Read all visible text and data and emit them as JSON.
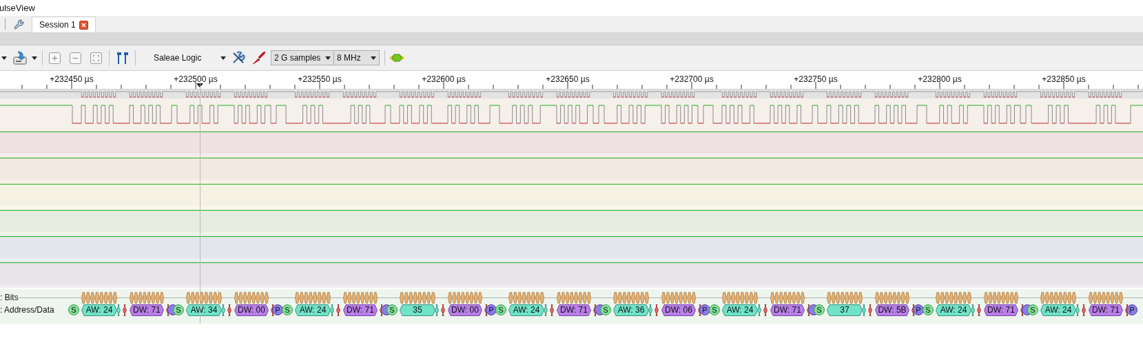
{
  "window": {
    "title": "ulseView"
  },
  "tabs": [
    {
      "label": "Session 1",
      "selected": true
    }
  ],
  "toolbar": {
    "device": "Saleae Logic",
    "sample_count": "2 G samples",
    "sample_rate": "8 MHz"
  },
  "ruler": {
    "labels": [
      "+232450 µs",
      "+232500 µs",
      "+232550 µs",
      "+232600 µs",
      "+232650 µs",
      "+232700 µs",
      "+232750 µs",
      "+232800 µs",
      "+232850 µs"
    ]
  },
  "decoder": {
    "rows": [
      ": Bits",
      ": Address/Data"
    ],
    "transactions": [
      {
        "start": "S",
        "address": "AW: 24",
        "data": "DW: 71",
        "stop_covered": true
      },
      {
        "start": "S",
        "address": "AW: 34",
        "data": "DW: 00",
        "stop": "P",
        "stop_covered": false
      },
      {
        "start": "S",
        "address": "AW: 24",
        "data": "DW: 71",
        "stop_covered": true
      },
      {
        "start": "S",
        "address": "35",
        "data": "DW: 00",
        "stop": "P",
        "stop_covered": false
      },
      {
        "start": "S",
        "address": "AW: 24",
        "data": "DW: 71",
        "stop_covered": true
      },
      {
        "start": "S",
        "address": "AW: 36",
        "data": "DW: 06",
        "stop": "P",
        "stop_covered": false
      },
      {
        "start": "S",
        "address": "AW: 24",
        "data": "DW: 71",
        "stop_covered": true
      },
      {
        "start": "S",
        "address": "37",
        "data": "DW: 5B",
        "stop": "P",
        "stop_covered": false
      },
      {
        "start": "S",
        "address": "AW: 24",
        "data": "DW: 71",
        "stop_covered": true
      },
      {
        "start": "S",
        "address": "AW: 24",
        "data": "DW: 71",
        "stop": "P",
        "stop_covered": false
      }
    ]
  }
}
